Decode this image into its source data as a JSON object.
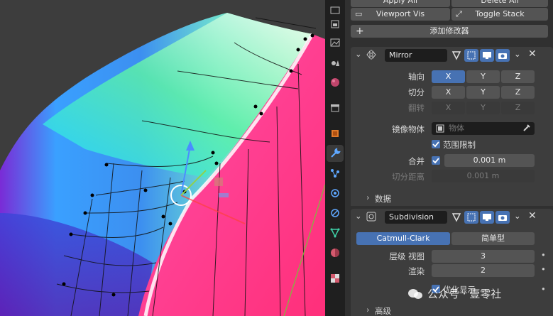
{
  "top_buttons": {
    "apply_all": "Apply All",
    "delete_all": "Delete All",
    "viewport_vis": "Viewport Vis",
    "toggle_stack": "Toggle Stack",
    "add_modifier": "添加修改器"
  },
  "mirror": {
    "name": "Mirror",
    "axis_label": "轴向",
    "bisect_label": "切分",
    "flip_label": "翻转",
    "x": "X",
    "y": "Y",
    "z": "Z",
    "mirror_object_label": "镜像物体",
    "mirror_object_placeholder": "物体",
    "clipping_label": "范围限制",
    "merge_label": "合并",
    "merge_value": "0.001 m",
    "bisect_distance_label": "切分距离",
    "bisect_distance_value": "0.001 m",
    "data_label": "数据"
  },
  "subdivision": {
    "name": "Subdivision",
    "catmull_clark": "Catmull-Clark",
    "simple": "简单型",
    "levels_viewport_label": "层级 视图",
    "levels_viewport_value": "3",
    "render_label": "渲染",
    "render_value": "2",
    "optimal_display_label": "优化显示",
    "advanced_label": "高级"
  },
  "watermark": "公众号 · 壹零社",
  "colors": {
    "accent": "#4772b3",
    "panel_bg": "#303030",
    "tab_bar": "#1f1f1f",
    "field": "#545454"
  },
  "icons": [
    "checkmark-icon",
    "close-icon",
    "wrench-icon",
    "camera-icon",
    "monitor-icon",
    "eyedropper-icon"
  ]
}
